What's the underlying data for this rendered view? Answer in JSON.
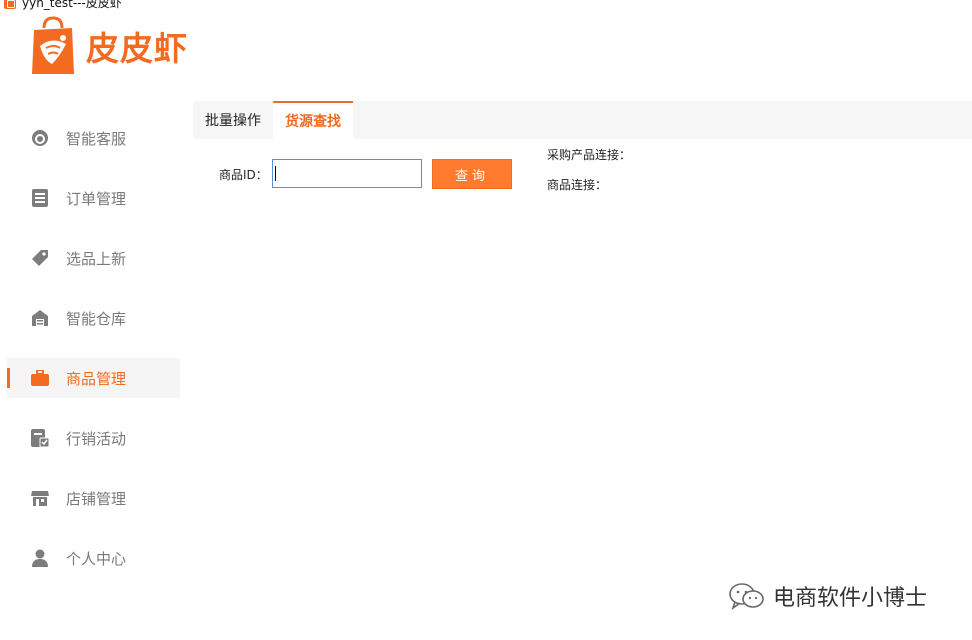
{
  "window": {
    "title": "yyn_test---皮皮虾"
  },
  "logo": {
    "text": "皮皮虾",
    "color": "#f26b21"
  },
  "sidebar": {
    "items": [
      {
        "label": "智能客服",
        "icon": "headset-icon",
        "active": false
      },
      {
        "label": "订单管理",
        "icon": "order-list-icon",
        "active": false
      },
      {
        "label": "选品上新",
        "icon": "tag-icon",
        "active": false
      },
      {
        "label": "智能仓库",
        "icon": "warehouse-icon",
        "active": false
      },
      {
        "label": "商品管理",
        "icon": "briefcase-icon",
        "active": true
      },
      {
        "label": "行销活动",
        "icon": "campaign-icon",
        "active": false
      },
      {
        "label": "店铺管理",
        "icon": "store-icon",
        "active": false
      },
      {
        "label": "个人中心",
        "icon": "user-icon",
        "active": false
      }
    ]
  },
  "tabs": [
    {
      "label": "批量操作",
      "active": false
    },
    {
      "label": "货源查找",
      "active": true
    }
  ],
  "form": {
    "id_label": "商品ID：",
    "id_value": "",
    "query_label": "查询"
  },
  "info": {
    "purchase_link_label": "采购产品连接：",
    "product_link_label": "商品连接："
  },
  "watermark": {
    "text": "电商软件小博士",
    "icon": "wechat-icon"
  },
  "colors": {
    "accent": "#f26b21",
    "button": "#ff7a2e",
    "input_border": "#5a8fd8"
  }
}
